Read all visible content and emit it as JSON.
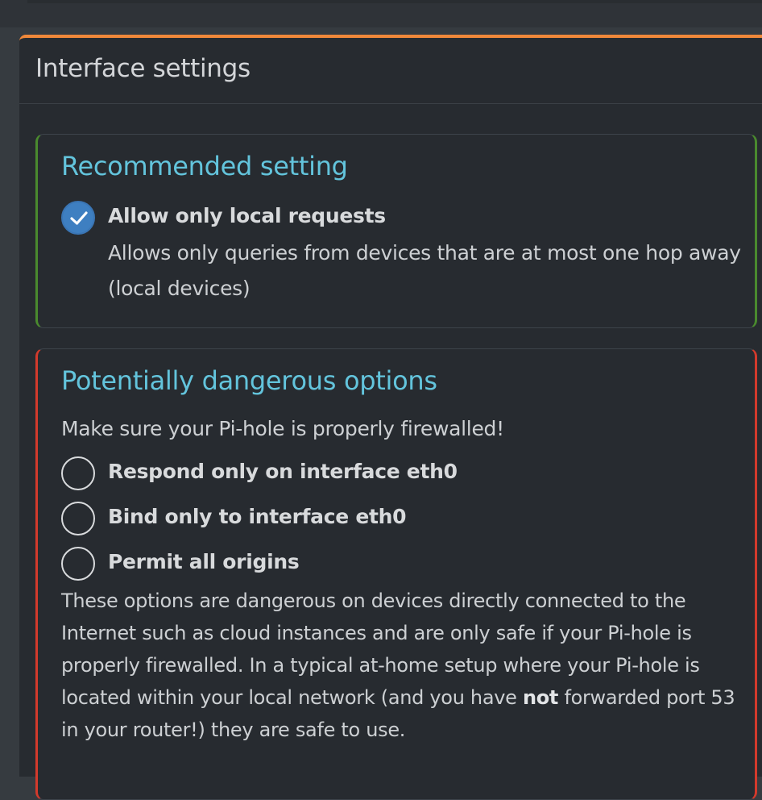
{
  "card": {
    "title": "Interface settings",
    "accent_color": "#f0883a"
  },
  "recommended": {
    "title": "Recommended setting",
    "border_color": "#4a8a2e",
    "option": {
      "label": "Allow only local requests",
      "checked": true,
      "description_line1": "Allows only queries from devices that are at most one hop away",
      "description_line2": "(local devices)"
    }
  },
  "dangerous": {
    "title": "Potentially dangerous options",
    "border_color": "#d33a2c",
    "warning": "Make sure your Pi-hole is properly firewalled!",
    "options": [
      {
        "label": "Respond only on interface eth0",
        "checked": false
      },
      {
        "label": "Bind only to interface eth0",
        "checked": false
      },
      {
        "label": "Permit all origins",
        "checked": false
      }
    ],
    "note": {
      "before": "These options are dangerous on devices directly connected to the Internet such as cloud instances and are only safe if your Pi-hole is properly firewalled. In a typical at-home setup where your Pi-hole is located within your local network (and you have ",
      "emphasis": "not",
      "after": " forwarded port 53 in your router!) they are safe to use."
    }
  },
  "icons": {
    "checked": "check-circle-icon",
    "unchecked": "radio-empty-icon"
  }
}
